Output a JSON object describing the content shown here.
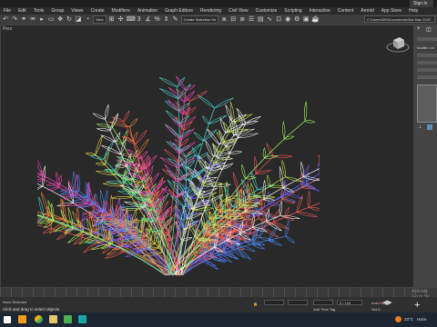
{
  "titlebar": {
    "signin": "Sign In"
  },
  "menu": [
    "File",
    "Edit",
    "Tools",
    "Group",
    "Views",
    "Create",
    "Modifiers",
    "Animation",
    "Graph Editors",
    "Rendering",
    "Civil View",
    "Customize",
    "Scripting",
    "Interactive",
    "Content",
    "Arnold",
    "App Store",
    "Help"
  ],
  "toolbar": {
    "view_select": "View",
    "selection_set": "Create Selection Se",
    "path": "C:\\Users\\DH\\Documents\\3ds Max 2020"
  },
  "viewport": {
    "label": "Pers"
  },
  "cmdpanel": {
    "modifier_list": "Modifier List"
  },
  "status": {
    "selection": "None Selected",
    "hint": "Click and drag to select objects",
    "add_time_tag": "Add Time Tag",
    "set_key": "Set K.",
    "auto_key": "Auto Key",
    "frame": "0 / 100"
  },
  "watermark": [
    "Activate",
    "Go to Se"
  ],
  "taskbar": {
    "temp": "23°C",
    "weather": "Haze"
  },
  "colors": {
    "bg": "#262626",
    "accent": "#5c8fb8"
  }
}
